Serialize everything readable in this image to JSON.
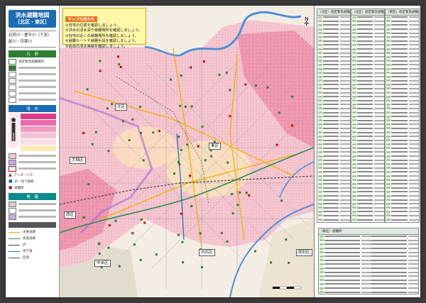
{
  "title": {
    "main": "洪水避難地図",
    "sub": "［北区・東区］"
  },
  "rivers": [
    "石狩川・豊平川（下流）",
    "創川・月寒川"
  ],
  "legend": {
    "section_label": "凡　例",
    "flood_section": "浸　水",
    "info_section": "情　報",
    "shelter_sym_label": "指定緊急避難場所",
    "items": [
      "学校",
      "指定緊急避難場所",
      "要配慮者利用施設",
      "避難所",
      "福祉避難所"
    ],
    "depth_colors": [
      "#dc3b8c",
      "#e96aa6",
      "#f19ac0",
      "#f6c1d6",
      "#f9dde6",
      "#fbe9b8"
    ],
    "symbols": [
      "アンダーパス",
      "JR・地下鉄駅",
      "避難所",
      "区役所"
    ],
    "lines": [
      {
        "label": "主要道路",
        "color": "#f0b000"
      },
      {
        "label": "高速道路",
        "color": "#2e8b57"
      },
      {
        "label": "JR",
        "color": "#444444"
      },
      {
        "label": "地下鉄",
        "color": "#1b6bb5"
      },
      {
        "label": "区境",
        "color": "#555555"
      }
    ]
  },
  "map": {
    "instructions_title": "マップの見かた",
    "instructions": [
      "①自宅の位置を確認しましょう。",
      "②洪水の浸水深や避難場所を確認しましょう。",
      "③自宅の近くの避難場所を確認しましょう。",
      "④避難ルートや避難手段を確認しましょう。",
      "⑤過去の浸水実績を確認しましょう。"
    ],
    "wards": [
      "北区",
      "東区",
      "手稲区",
      "西区",
      "中央区",
      "白石区",
      "厚別区"
    ],
    "compass": "N",
    "colors": {
      "land": "#f7e7d9",
      "flood_light": "#f4c6cf",
      "flood_mid": "#ee9ab0",
      "flood_deep": "#e66ea0",
      "river": "#4d8fd6",
      "road": "#f0b000",
      "expressway": "#2e8b57"
    }
  },
  "lists": {
    "headers": [
      "（北区）指定緊急避難場所",
      "（北区）指定緊急避難場所",
      "（東区）指定緊急避難場所"
    ],
    "bottom_header": "（東区）避難所"
  }
}
